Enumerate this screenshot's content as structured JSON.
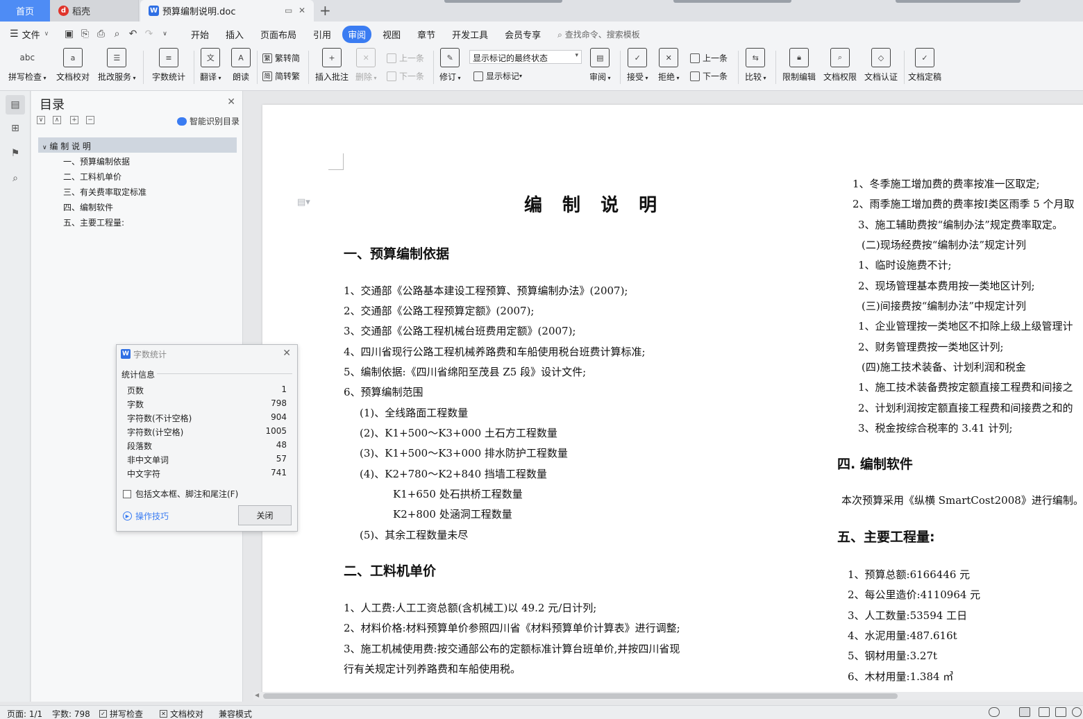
{
  "tabs": {
    "home": "首页",
    "daoke": "稻壳",
    "doc": "预算编制说明.doc",
    "new_tab": "+"
  },
  "menu": {
    "file": "文件",
    "items": [
      "开始",
      "插入",
      "页面布局",
      "引用",
      "审阅",
      "视图",
      "章节",
      "开发工具",
      "会员专享"
    ],
    "active": "审阅",
    "search_placeholder": "查找命令、搜索模板"
  },
  "ribbon": {
    "spell_check": "拼写检查",
    "doc_proof": "文档校对",
    "batch_service": "批改服务",
    "word_count": "字数统计",
    "translate": "翻译",
    "read_aloud": "朗读",
    "trad_to_simp": "繁转简",
    "simp_to_trad": "简转繁",
    "insert_comment": "插入批注",
    "delete": "删除",
    "prev_comment": "上一条",
    "next_comment": "下一条",
    "track_changes": "修订",
    "markup_state": "显示标记的最终状态",
    "show_markup": "显示标记",
    "review": "审阅",
    "accept": "接受",
    "reject": "拒绝",
    "prev_change": "上一条",
    "next_change": "下一条",
    "compare": "比较",
    "restrict_edit": "限制编辑",
    "doc_rights": "文档权限",
    "doc_auth": "文档认证",
    "doc_finalize": "文档定稿"
  },
  "toc": {
    "title": "目录",
    "smart": "智能识别目录",
    "root": "编 制 说 明",
    "items": [
      "一、预算编制依据",
      "二、工料机单价",
      "三、有关费率取定标准",
      "四、编制软件",
      "五、主要工程量:"
    ]
  },
  "document": {
    "title": "编 制 说 明",
    "s1": "一、预算编制依据",
    "s1_items": [
      "1、交通部《公路基本建设工程预算、预算编制办法》(2007);",
      "2、交通部《公路工程预算定额》(2007);",
      "3、交通部《公路工程机械台班费用定额》(2007);",
      "4、四川省现行公路工程机械养路费和车船使用税台班费计算标准;",
      "5、编制依据:《四川省绵阳至茂县 Z5 段》设计文件;",
      "6、预算编制范围",
      "(1)、全线路面工程数量",
      "(2)、K1+500～K3+000 土石方工程数量",
      "(3)、K1+500～K3+000 排水防护工程数量",
      "(4)、K2+780～K2+840 挡墙工程数量",
      "K1+650 处石拱桥工程数量",
      "K2+800 处涵洞工程数量",
      "(5)、其余工程数量未尽"
    ],
    "s2": "二、工料机单价",
    "s2_items": [
      "1、人工费:人工工资总额(含机械工)以 49.2 元/日计列;",
      "2、材料价格:材料预算单价参照四川省《材料预算单价计算表》进行调整;",
      "3、施工机械使用费:按交通部公布的定额标准计算台班单价,并按四川省现",
      "行有关规定计列养路费和车船使用税。"
    ],
    "right_items": [
      "1、冬季施工增加费的费率按准一区取定;",
      "2、雨季施工增加费的费率按Ⅰ类区雨季 5 个月取",
      "3、施工辅助费按“编制办法”规定费率取定。",
      "(二)现场经费按“编制办法”规定计列",
      "1、临时设施费不计;",
      "2、现场管理基本费用按一类地区计列;",
      "(三)间接费按“编制办法”中规定计列",
      "1、企业管理按一类地区不扣除上级上级管理计",
      "2、财务管理费按一类地区计列;",
      "(四)施工技术装备、计划利润和税金",
      "1、施工技术装备费按定额直接工程费和间接之",
      "2、计划利润按定额直接工程费和间接费之和的",
      "3、税金按综合税率的 3.41 计列;"
    ],
    "s4": "四. 编制软件",
    "s4_text": "本次预算采用《纵横 SmartCost2008》进行编制。",
    "s5": "五、主要工程量:",
    "s5_items": [
      "1、预算总额:6166446 元",
      "2、每公里造价:4110964 元",
      "3、人工数量:53594 工日",
      "4、水泥用量:487.616t",
      "5、钢材用量:3.27t",
      "6、木材用量:1.384 ㎥"
    ]
  },
  "word_count": {
    "title": "字数统计",
    "section": "统计信息",
    "rows": [
      {
        "label": "页数",
        "value": "1"
      },
      {
        "label": "字数",
        "value": "798"
      },
      {
        "label": "字符数(不计空格)",
        "value": "904"
      },
      {
        "label": "字符数(计空格)",
        "value": "1005"
      },
      {
        "label": "段落数",
        "value": "48"
      },
      {
        "label": "非中文单词",
        "value": "57"
      },
      {
        "label": "中文字符",
        "value": "741"
      }
    ],
    "include_label": "包括文本框、脚注和尾注(F)",
    "tips": "操作技巧",
    "close": "关闭"
  },
  "status": {
    "page": "页面: 1/1",
    "words": "字数: 798",
    "spell": "拼写检查",
    "proof": "文档校对",
    "compat": "兼容模式"
  },
  "colors": {
    "accent": "#3a7cf2",
    "home_tab": "#4e8cf5",
    "toc_selected": "#cfd6df"
  }
}
